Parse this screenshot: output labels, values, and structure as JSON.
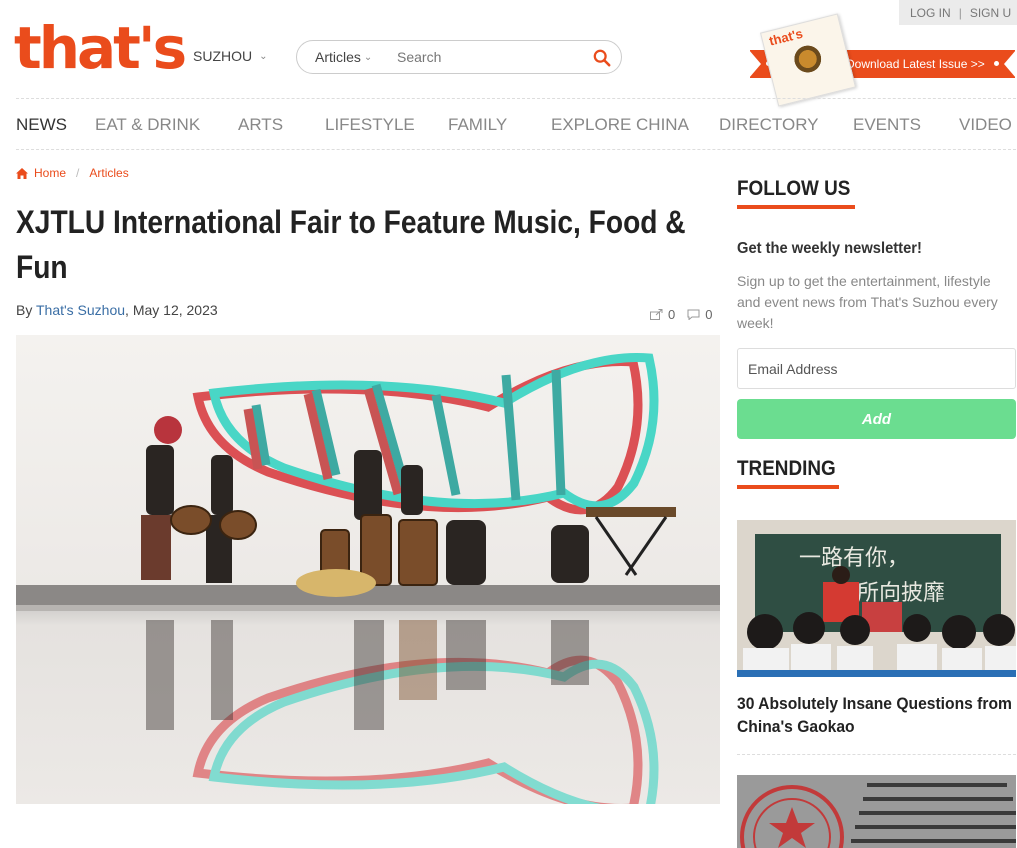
{
  "auth": {
    "login": "LOG IN",
    "separator": "|",
    "signup": "SIGN U"
  },
  "brand": {
    "logo": "that's",
    "accent_color": "#ea4c1c"
  },
  "header": {
    "city": "SUZHOU",
    "search": {
      "category": "Articles",
      "placeholder": "Search"
    },
    "download": {
      "label": "Download Latest Issue >>",
      "cover_logo": "that's"
    }
  },
  "nav": {
    "items": [
      "NEWS",
      "EAT & DRINK",
      "ARTS",
      "LIFESTYLE",
      "FAMILY",
      "EXPLORE CHINA",
      "DIRECTORY",
      "EVENTS",
      "VIDEO"
    ],
    "active": "NEWS"
  },
  "breadcrumb": {
    "home": "Home",
    "separator": "/",
    "current": "Articles"
  },
  "article": {
    "title": "XJTLU International Fair to Feature Music, Food & Fun",
    "by": "By",
    "author": "That's Suzhou",
    "date": ", May 12, 2023",
    "shares": "0",
    "comments": "0"
  },
  "sidebar": {
    "follow_heading": "FOLLOW US",
    "newsletter_title": "Get the weekly newsletter!",
    "newsletter_desc": "Sign up to get the entertainment, lifestyle and event news from That's Suzhou every week!",
    "email_placeholder": "Email Address",
    "add_label": "Add",
    "add_color": "#6bdd90",
    "trending_heading": "TRENDING",
    "trending": [
      {
        "title": "30 Absolutely Insane Questions from China's Gaokao",
        "board_text_1": "一路有你，",
        "board_text_2": "所向披靡"
      }
    ]
  }
}
